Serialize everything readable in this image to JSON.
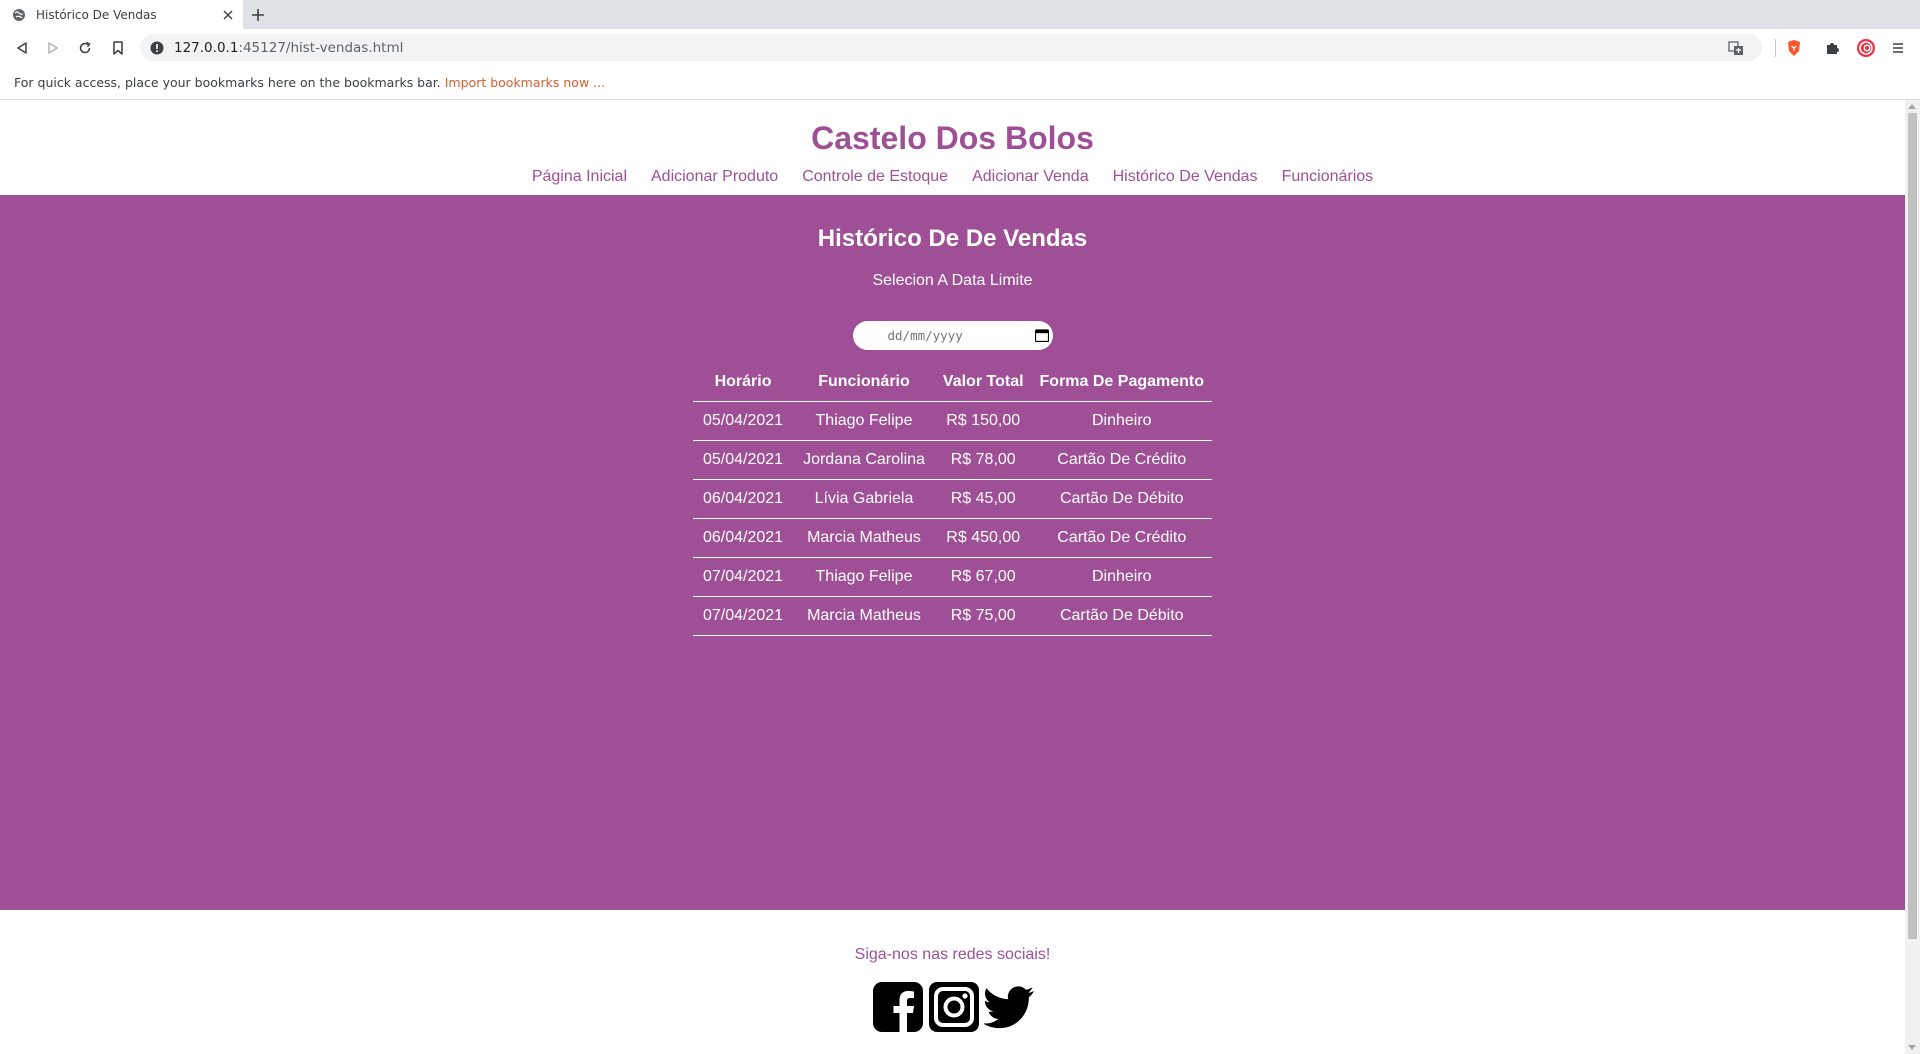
{
  "browser": {
    "tab_title": "Histórico De Vendas",
    "url_host": "127.0.0.1",
    "url_rest": ":45127/hist-vendas.html",
    "bookmarks_text": "For quick access, place your bookmarks here on the bookmarks bar.",
    "bookmarks_link": "Import bookmarks now ..."
  },
  "header": {
    "brand": "Castelo Dos Bolos",
    "nav": [
      "Página Inicial",
      "Adicionar Produto",
      "Controle de Estoque",
      "Adicionar Venda",
      "Histórico De Vendas",
      "Funcionários"
    ]
  },
  "main": {
    "title": "Histórico De De Vendas",
    "subtitle": "Selecion A Data Limite",
    "date_placeholder": "dd/mm/yyyy",
    "table": {
      "columns": [
        "Horário",
        "Funcionário",
        "Valor Total",
        "Forma De Pagamento"
      ],
      "rows": [
        [
          "05/04/2021",
          "Thiago Felipe",
          "R$ 150,00",
          "Dinheiro"
        ],
        [
          "05/04/2021",
          "Jordana Carolina",
          "R$ 78,00",
          "Cartão De Crédito"
        ],
        [
          "06/04/2021",
          "Lívia Gabriela",
          "R$ 45,00",
          "Cartão De Débito"
        ],
        [
          "06/04/2021",
          "Marcia Matheus",
          "R$ 450,00",
          "Cartão De Crédito"
        ],
        [
          "07/04/2021",
          "Thiago Felipe",
          "R$ 67,00",
          "Dinheiro"
        ],
        [
          "07/04/2021",
          "Marcia Matheus",
          "R$ 75,00",
          "Cartão De Débito"
        ]
      ]
    }
  },
  "footer": {
    "follow_text": "Siga-nos nas redes sociais!",
    "social": [
      "facebook-icon",
      "instagram-icon",
      "twitter-icon"
    ]
  },
  "colors": {
    "brand": "#9e4f96",
    "text_on_brand": "#ffffff",
    "import_link": "#d85d2f"
  }
}
